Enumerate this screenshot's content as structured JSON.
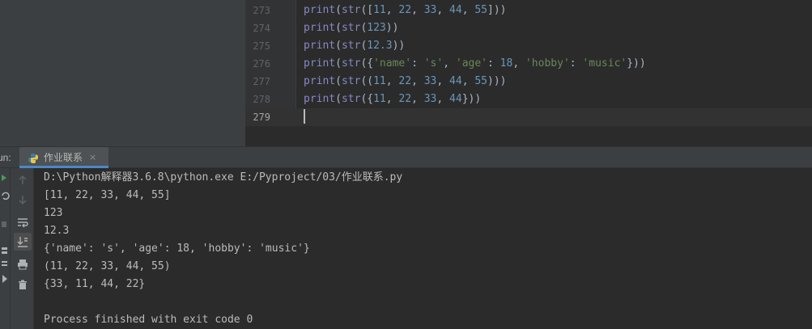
{
  "editor": {
    "lines": [
      {
        "num": "273",
        "tokens": [
          [
            "fn",
            "print"
          ],
          [
            "p",
            "("
          ],
          [
            "fn",
            "str"
          ],
          [
            "p",
            "(["
          ],
          [
            "n",
            "11"
          ],
          [
            "p",
            ", "
          ],
          [
            "n",
            "22"
          ],
          [
            "p",
            ", "
          ],
          [
            "n",
            "33"
          ],
          [
            "p",
            ", "
          ],
          [
            "n",
            "44"
          ],
          [
            "p",
            ", "
          ],
          [
            "n",
            "55"
          ],
          [
            "p",
            "]))"
          ]
        ]
      },
      {
        "num": "274",
        "tokens": [
          [
            "fn",
            "print"
          ],
          [
            "p",
            "("
          ],
          [
            "fn",
            "str"
          ],
          [
            "p",
            "("
          ],
          [
            "n",
            "123"
          ],
          [
            "p",
            "))"
          ]
        ]
      },
      {
        "num": "275",
        "tokens": [
          [
            "fn",
            "print"
          ],
          [
            "p",
            "("
          ],
          [
            "fn",
            "str"
          ],
          [
            "p",
            "("
          ],
          [
            "n",
            "12.3"
          ],
          [
            "p",
            "))"
          ]
        ]
      },
      {
        "num": "276",
        "tokens": [
          [
            "fn",
            "print"
          ],
          [
            "p",
            "("
          ],
          [
            "fn",
            "str"
          ],
          [
            "p",
            "({"
          ],
          [
            "s",
            "'name'"
          ],
          [
            "p",
            ": "
          ],
          [
            "s",
            "'s'"
          ],
          [
            "p",
            ", "
          ],
          [
            "s",
            "'age'"
          ],
          [
            "p",
            ": "
          ],
          [
            "n",
            "18"
          ],
          [
            "p",
            ", "
          ],
          [
            "s",
            "'hobby'"
          ],
          [
            "p",
            ": "
          ],
          [
            "s",
            "'music'"
          ],
          [
            "p",
            "}))"
          ]
        ]
      },
      {
        "num": "277",
        "tokens": [
          [
            "fn",
            "print"
          ],
          [
            "p",
            "("
          ],
          [
            "fn",
            "str"
          ],
          [
            "p",
            "(("
          ],
          [
            "n",
            "11"
          ],
          [
            "p",
            ", "
          ],
          [
            "n",
            "22"
          ],
          [
            "p",
            ", "
          ],
          [
            "n",
            "33"
          ],
          [
            "p",
            ", "
          ],
          [
            "n",
            "44"
          ],
          [
            "p",
            ", "
          ],
          [
            "n",
            "55"
          ],
          [
            "p",
            ")))"
          ]
        ]
      },
      {
        "num": "278",
        "tokens": [
          [
            "fn",
            "print"
          ],
          [
            "p",
            "("
          ],
          [
            "fn",
            "str"
          ],
          [
            "p",
            "({"
          ],
          [
            "n",
            "11"
          ],
          [
            "p",
            ", "
          ],
          [
            "n",
            "22"
          ],
          [
            "p",
            ", "
          ],
          [
            "n",
            "33"
          ],
          [
            "p",
            ", "
          ],
          [
            "n",
            "44"
          ],
          [
            "p",
            "}))"
          ]
        ]
      },
      {
        "num": "279",
        "tokens": []
      }
    ]
  },
  "run": {
    "label": "un:",
    "tab_label": "作业联系",
    "tab_close": "×"
  },
  "console": {
    "lines": [
      "D:\\Python解释器3.6.8\\python.exe E:/Pyproject/03/作业联系.py",
      "[11, 22, 33, 44, 55]",
      "123",
      "12.3",
      "{'name': 's', 'age': 18, 'hobby': 'music'}",
      "(11, 22, 33, 44, 55)",
      "{33, 11, 44, 22}",
      "",
      "Process finished with exit code 0"
    ]
  },
  "colors": {
    "function": "#8888c6",
    "punct": "#a9b7c6",
    "number": "#6897bb",
    "string": "#6a8759"
  },
  "toolbar_icons": [
    "rerun-icon",
    "stop-icon",
    "scroll-up-icon",
    "scroll-down-icon",
    "soft-wrap-icon",
    "scroll-to-end-icon",
    "print-icon",
    "trash-icon"
  ]
}
